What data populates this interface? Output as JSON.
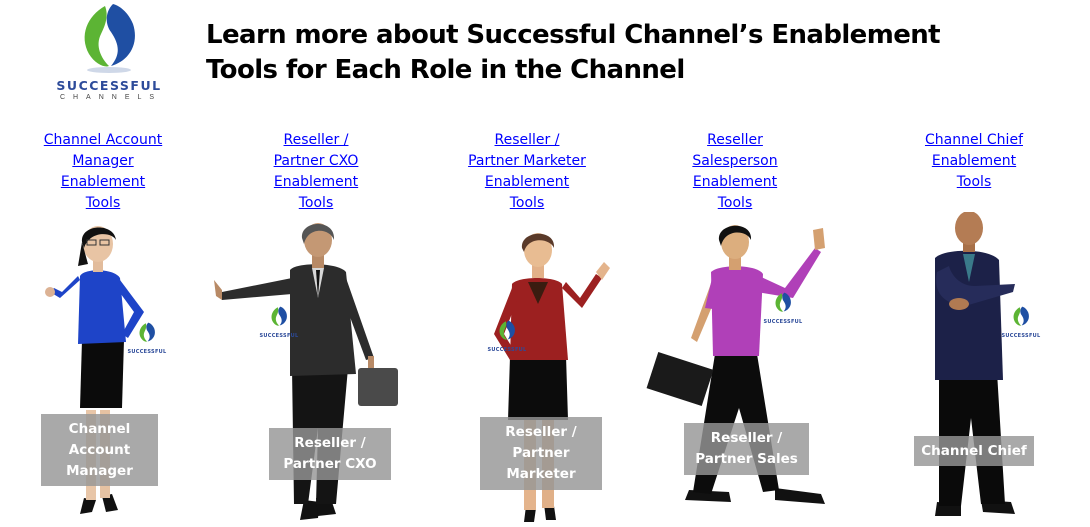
{
  "logo": {
    "brand": "SUCCESSFUL",
    "sub": "CHANNELS",
    "colors": {
      "green": "#5cb434",
      "blue": "#1f4fa3",
      "text": "#2d4b9a"
    }
  },
  "title": {
    "line1": "Learn more about Successful Channel’s Enablement",
    "line2": "Tools for Each Role in the Channel"
  },
  "roles": [
    {
      "link_lines": [
        "Channel Account",
        "Manager",
        "Enablement",
        "Tools"
      ],
      "caption_lines": [
        "Channel",
        "Account",
        "Manager"
      ],
      "outfit": "blue blouse, black skirt"
    },
    {
      "link_lines": [
        "Reseller /",
        "Partner CXO",
        "Enablement",
        "Tools"
      ],
      "caption_lines": [
        "Reseller /",
        "Partner CXO"
      ],
      "outfit": "dark suit with briefcase"
    },
    {
      "link_lines": [
        "Reseller /",
        "Partner Marketer",
        "Enablement",
        "Tools"
      ],
      "caption_lines": [
        "Reseller /",
        "Partner",
        "Marketer"
      ],
      "outfit": "red top, black skirt"
    },
    {
      "link_lines": [
        "Reseller",
        "Salesperson",
        "Enablement",
        "Tools"
      ],
      "caption_lines": [
        "Reseller /",
        "Partner Sales"
      ],
      "outfit": "purple shirt with briefcase"
    },
    {
      "link_lines": [
        "Channel Chief",
        "Enablement",
        "Tools"
      ],
      "caption_lines": [
        "Channel Chief"
      ],
      "outfit": "navy suit, arms crossed"
    }
  ],
  "badge_text": "SUCCESSFUL",
  "link_color": "#0000ff"
}
